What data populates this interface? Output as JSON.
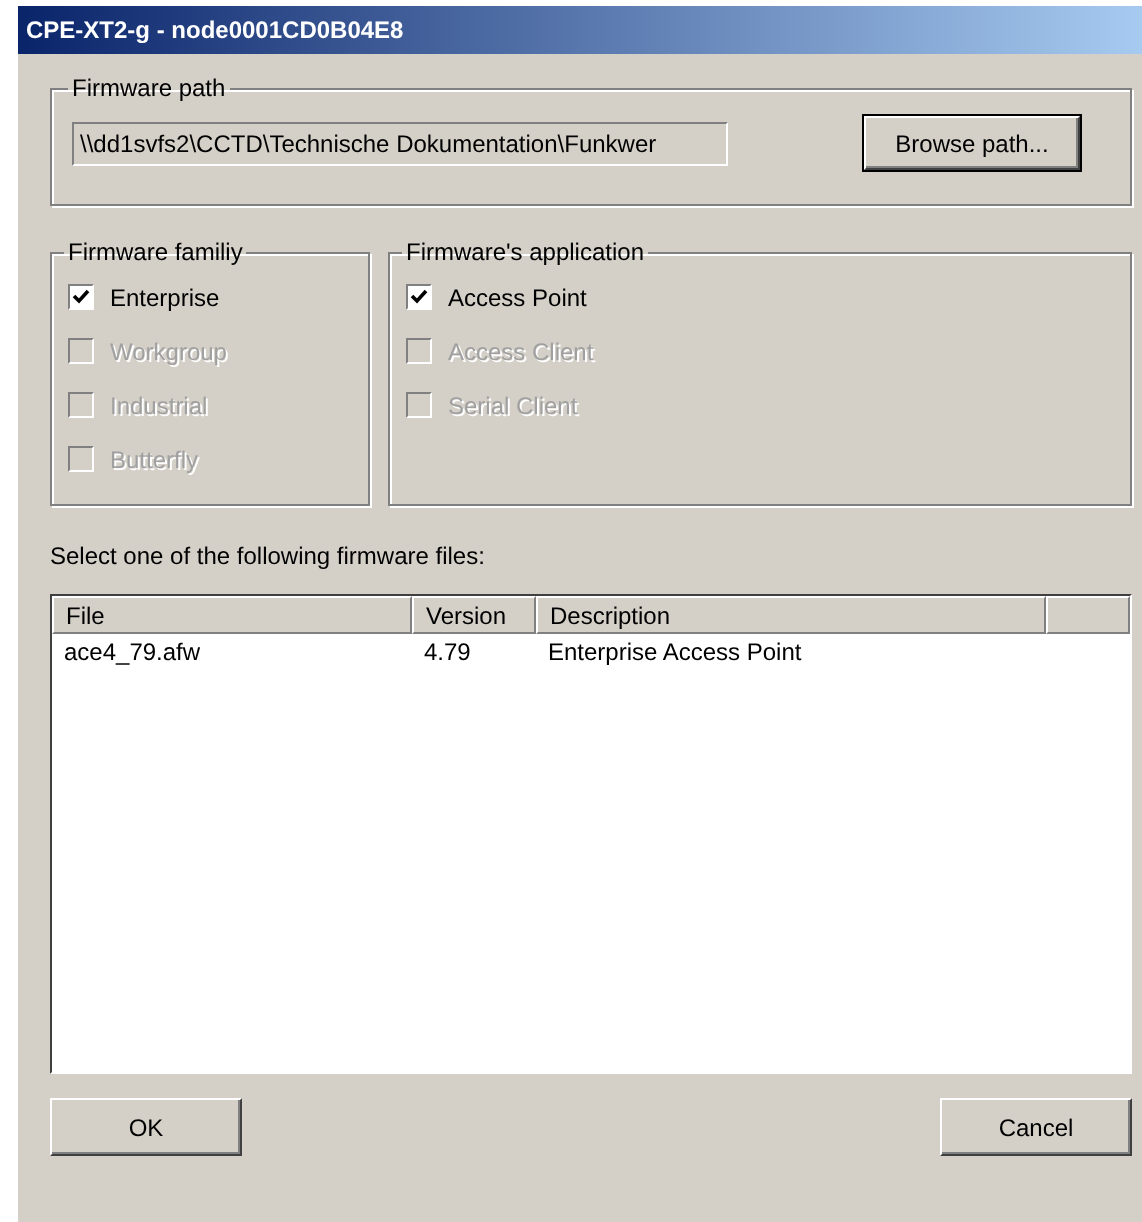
{
  "window": {
    "title": "CPE-XT2-g - node0001CD0B04E8"
  },
  "firmware_path": {
    "legend": "Firmware path",
    "value": "\\\\dd1svfs2\\CCTD\\Technische Dokumentation\\Funkwer",
    "button": "Browse path..."
  },
  "firmware_family": {
    "legend": "Firmware familiy",
    "options": [
      {
        "label": "Enterprise",
        "checked": true,
        "disabled": false
      },
      {
        "label": "Workgroup",
        "checked": false,
        "disabled": true
      },
      {
        "label": "Industrial",
        "checked": false,
        "disabled": true
      },
      {
        "label": "Butterfly",
        "checked": false,
        "disabled": true
      }
    ]
  },
  "firmware_application": {
    "legend": "Firmware's application",
    "options": [
      {
        "label": "Access Point",
        "checked": true,
        "disabled": false
      },
      {
        "label": "Access Client",
        "checked": false,
        "disabled": true
      },
      {
        "label": "Serial Client",
        "checked": false,
        "disabled": true
      }
    ]
  },
  "files_label": "Select one of the following firmware files:",
  "table": {
    "columns": [
      "File",
      "Version",
      "Description"
    ],
    "rows": [
      {
        "cells": [
          "ace4_79.afw",
          "4.79",
          "Enterprise Access Point"
        ],
        "selected": false
      }
    ]
  },
  "buttons": [
    "OK",
    "Cancel"
  ]
}
